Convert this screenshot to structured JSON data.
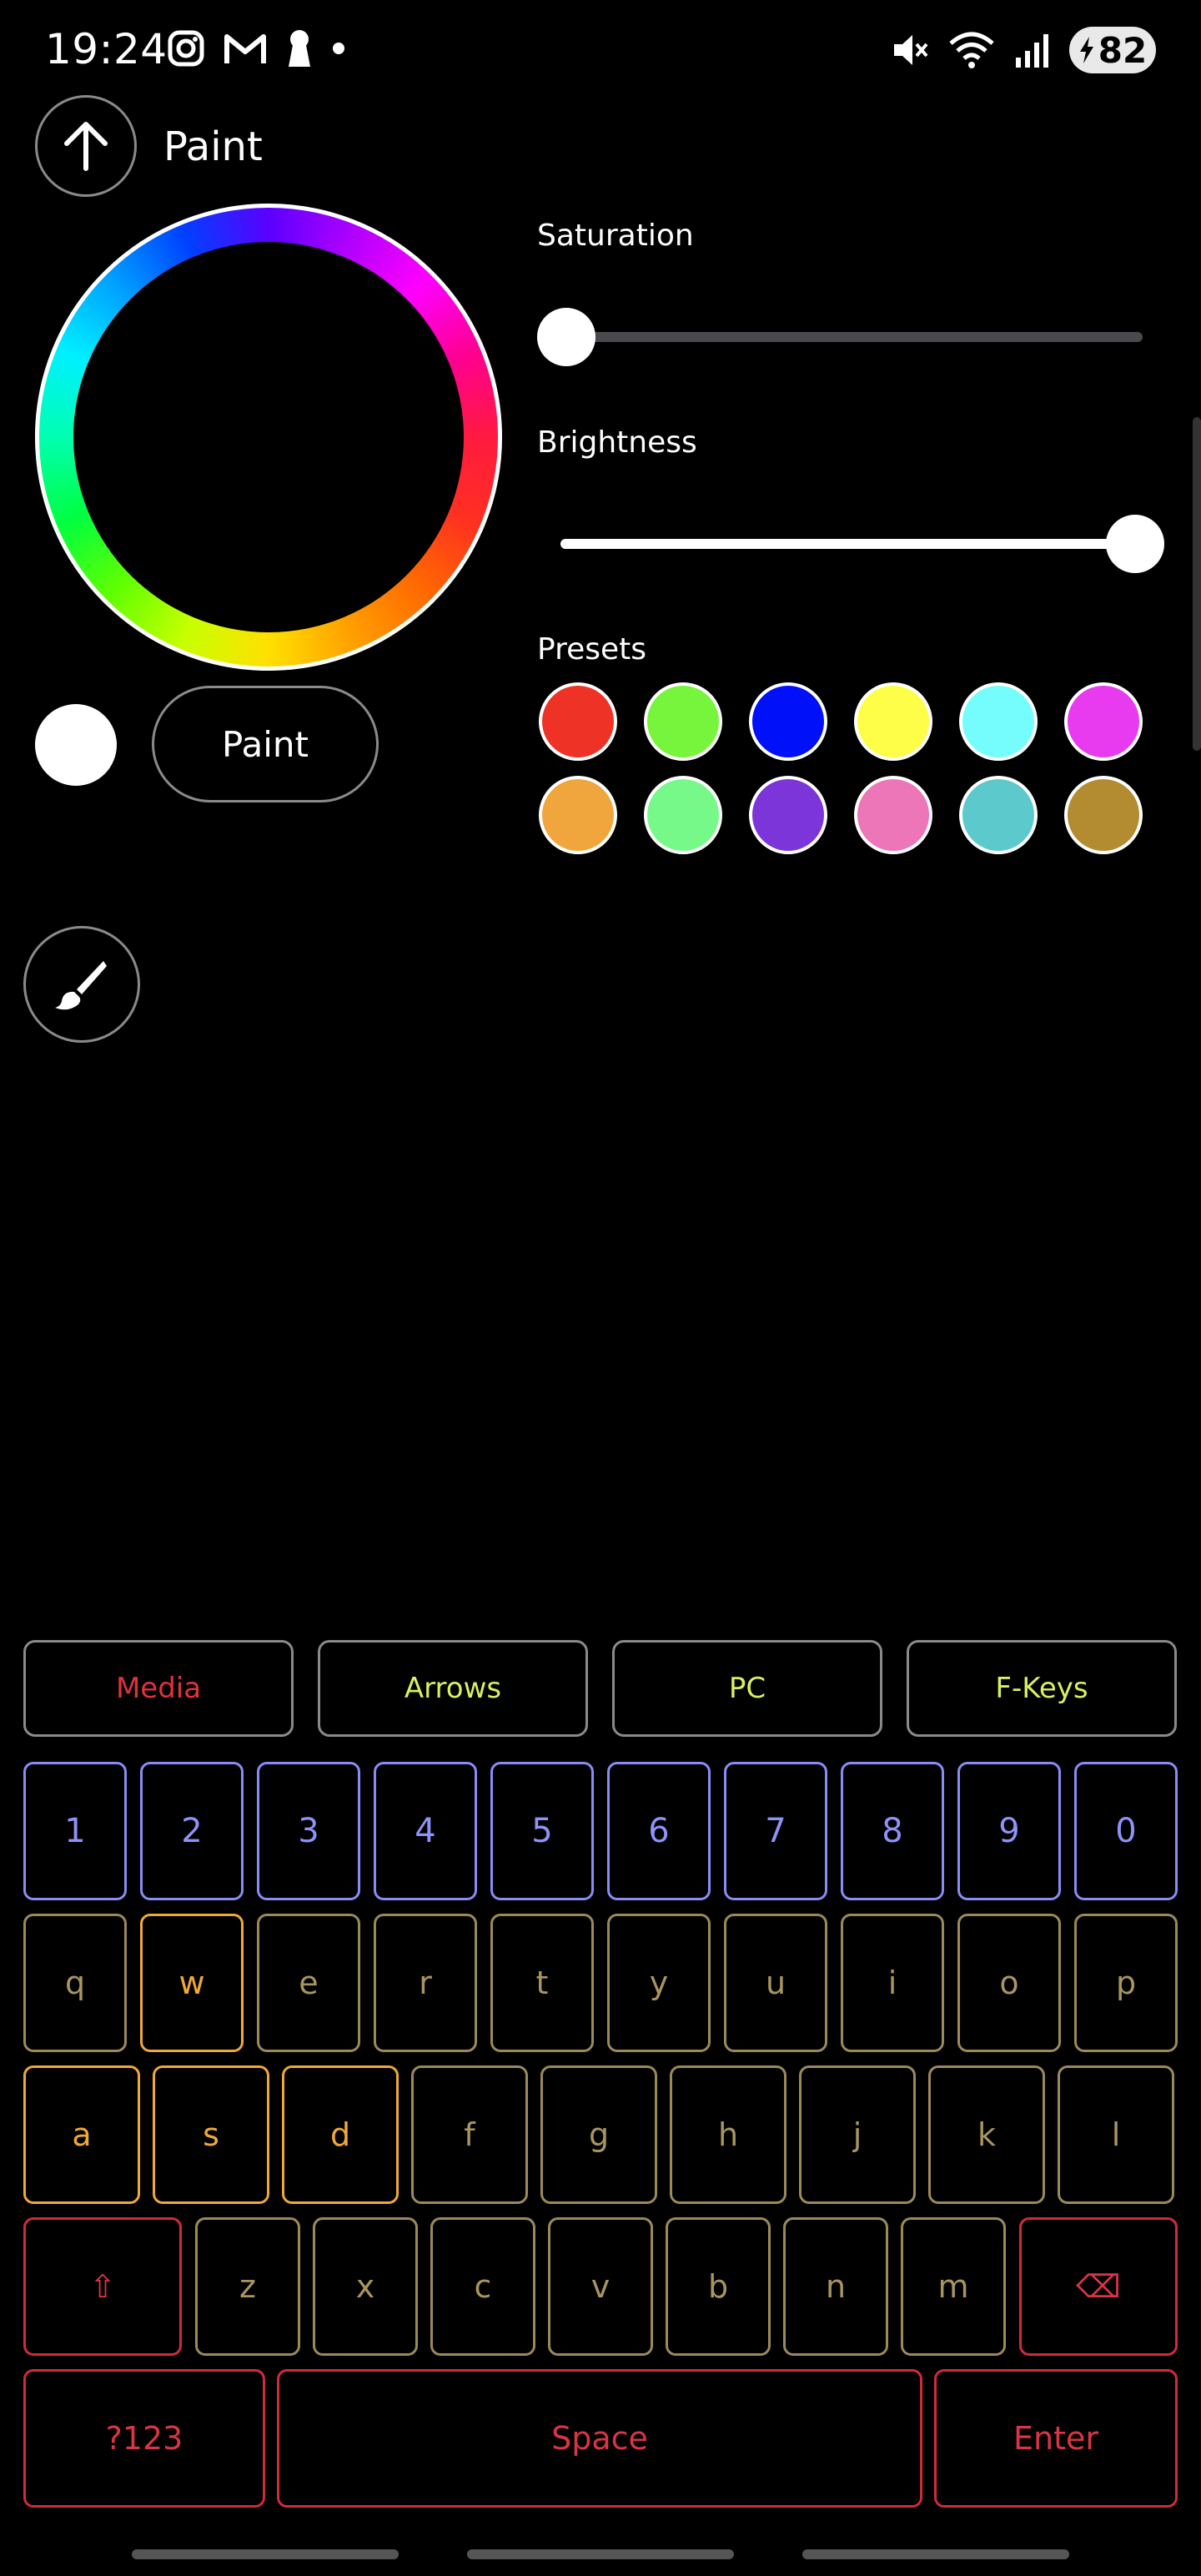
{
  "status": {
    "time": "19:24",
    "battery": "82",
    "left_icons": [
      "instagram-icon",
      "gmail-icon",
      "keyhole-icon",
      "dot-icon"
    ],
    "right_icons": [
      "mute-icon",
      "wifi-icon",
      "signal-icon"
    ]
  },
  "header": {
    "title": "Paint",
    "back_icon": "arrow-up-icon"
  },
  "controls": {
    "saturation_label": "Saturation",
    "saturation_value": 0.0,
    "brightness_label": "Brightness",
    "brightness_value": 1.0,
    "presets_label": "Presets",
    "paint_label": "Paint",
    "current_color": "#ffffff"
  },
  "presets": [
    "#ee3326",
    "#76f53c",
    "#0010f8",
    "#fefe49",
    "#75fcfd",
    "#e83aee",
    "#f0a63c",
    "#77f98a",
    "#7c35d8",
    "#ed76b8",
    "#5cc9cc",
    "#b38b31"
  ],
  "keyboard": {
    "tabs": [
      {
        "label": "Media",
        "color": "#e0323e"
      },
      {
        "label": "Arrows",
        "color": "#d8f060"
      },
      {
        "label": "PC",
        "color": "#d8f060"
      },
      {
        "label": "F-Keys",
        "color": "#d8f060"
      }
    ],
    "numbers": [
      "1",
      "2",
      "3",
      "4",
      "5",
      "6",
      "7",
      "8",
      "9",
      "0"
    ],
    "row_q": [
      "q",
      "w",
      "e",
      "r",
      "t",
      "y",
      "u",
      "i",
      "o",
      "p"
    ],
    "row_a": [
      "a",
      "s",
      "d",
      "f",
      "g",
      "h",
      "j",
      "k",
      "l"
    ],
    "row_z": [
      "z",
      "x",
      "c",
      "v",
      "b",
      "n",
      "m"
    ],
    "shift": "⇧",
    "backspace": "⌫",
    "symbols": "?123",
    "space": "Space",
    "enter": "Enter"
  }
}
